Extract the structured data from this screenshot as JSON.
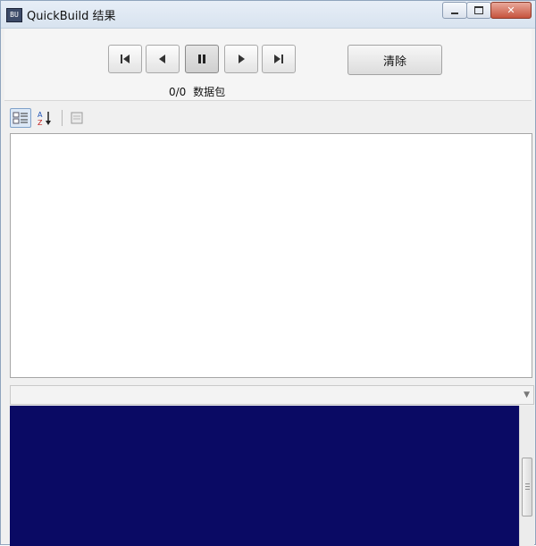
{
  "window": {
    "title": "QuickBuild 结果",
    "icon_text": "BU"
  },
  "toolbar": {
    "clear_label": "清除",
    "packet_count": "0/0",
    "packet_label": "数据包",
    "pause_active": true
  },
  "colors": {
    "log_background": "#0a0a64",
    "close_button": "#c6533e"
  },
  "icons": [
    "first-icon",
    "previous-icon",
    "pause-icon",
    "next-icon",
    "last-icon",
    "categorized-icon",
    "alphabetical-sort-icon",
    "property-pages-icon",
    "minimize-icon",
    "maximize-icon",
    "close-icon",
    "chevron-down-icon"
  ]
}
